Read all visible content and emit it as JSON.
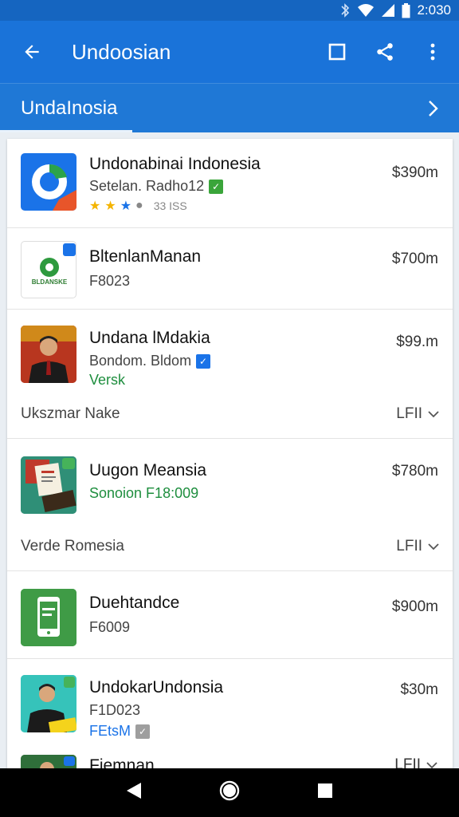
{
  "status_bar": {
    "time": "2:030"
  },
  "app_bar": {
    "title": "Undoosian",
    "back_icon": "arrow-back-icon",
    "actions": [
      "bookmark-icon",
      "share-icon",
      "more-vert-icon"
    ]
  },
  "sub_bar": {
    "label": "UndaInosia",
    "chevron_icon": "chevron-right-icon"
  },
  "list": {
    "items": [
      {
        "name": "Undonabinai Indonesia",
        "subtitle": "Setelan. Radho12",
        "rating_text": "33 ISS",
        "price": "$390m"
      },
      {
        "name": "BltenlanManan",
        "subtitle": "F8023",
        "logo_caption": "BLDANSKE",
        "price": "$700m"
      },
      {
        "name": "Undana lMdakia",
        "subtitle": "Bondom. Bldom",
        "subtitle2": "Versk",
        "price": "$99.m"
      },
      {
        "name": "Uugon Meansia",
        "subtitle": "Sonoion F18:009",
        "price": "$780m"
      },
      {
        "name": "Duehtandce",
        "subtitle": "F6009",
        "price": "$900m"
      },
      {
        "name": "UndokarUndonsia",
        "subtitle": "F1D023",
        "subtitle2": "FEtsM",
        "price": "$30m"
      },
      {
        "name": "Fiemnan"
      }
    ],
    "footers": [
      {
        "label": "Ukszmar Nake",
        "right": "LFII"
      },
      {
        "label": "Verde Romesia",
        "right": "LFII"
      },
      {
        "right": "LFII"
      }
    ]
  },
  "colors": {
    "primary": "#1a73d9",
    "primary_dark": "#1565c0",
    "green_text": "#1e8e3e",
    "star": "#f4b400"
  }
}
